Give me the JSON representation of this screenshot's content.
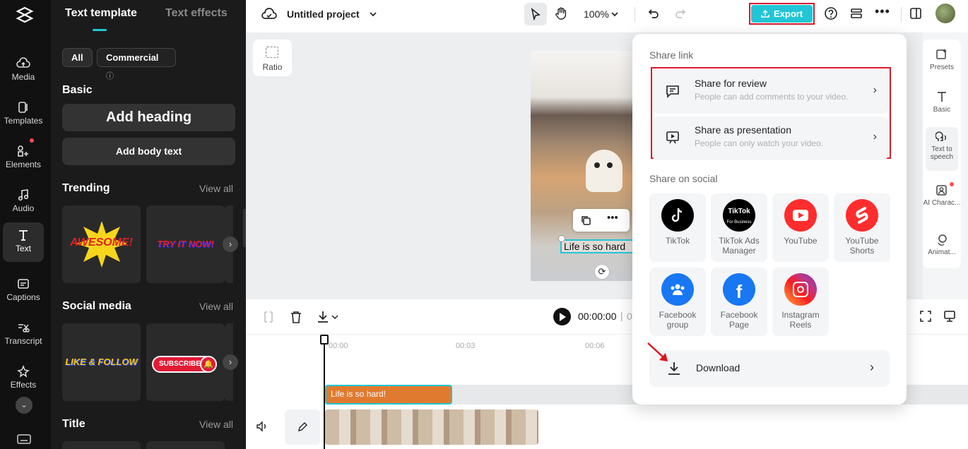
{
  "rail": {
    "items": [
      {
        "label": "Media"
      },
      {
        "label": "Templates"
      },
      {
        "label": "Elements"
      },
      {
        "label": "Audio"
      },
      {
        "label": "Text"
      },
      {
        "label": "Captions"
      },
      {
        "label": "Transcript"
      },
      {
        "label": "Effects"
      }
    ]
  },
  "panel": {
    "tabs": [
      "Text template",
      "Text effects"
    ],
    "filters": [
      "All",
      "Commercial"
    ],
    "basic": {
      "title": "Basic",
      "add_heading": "Add heading",
      "add_body": "Add body text"
    },
    "trending": {
      "title": "Trending",
      "view_all": "View all",
      "items": [
        "AWESOME!",
        "TRY IT NOW!"
      ]
    },
    "social": {
      "title": "Social media",
      "view_all": "View all",
      "items": [
        "LIKE & FOLLOW",
        "SUBSCRIBE"
      ]
    },
    "title_sec": {
      "title": "Title",
      "view_all": "View all"
    }
  },
  "topbar": {
    "project_name": "Untitled project",
    "zoom": "100%",
    "export_label": "Export"
  },
  "canvas": {
    "ratio_label": "Ratio",
    "caption_text": "Life is so hard"
  },
  "rightbar": {
    "items": [
      {
        "label": "Presets"
      },
      {
        "label": "Basic"
      },
      {
        "label": "Text to speech"
      },
      {
        "label": "AI Charac..."
      },
      {
        "label": "Animat..."
      }
    ]
  },
  "timeline": {
    "time": "00:00:00",
    "time_sep": "0",
    "ruler": [
      "00:00",
      "00:03",
      "00:06"
    ],
    "clip_text": "Life is so hard!"
  },
  "share": {
    "share_link_heading": "Share link",
    "review": {
      "title": "Share for review",
      "subtitle": "People can add comments to your video."
    },
    "presentation": {
      "title": "Share as presentation",
      "subtitle": "People can only watch your video."
    },
    "social_heading": "Share on social",
    "social": [
      {
        "label": "TikTok",
        "color": "#000000"
      },
      {
        "label": "TikTok Ads Manager",
        "color": "#000000"
      },
      {
        "label": "YouTube",
        "color": "#ff0000"
      },
      {
        "label": "YouTube Shorts",
        "color": "#ff2b2b"
      },
      {
        "label": "Facebook group",
        "color": "#1877f2"
      },
      {
        "label": "Facebook Page",
        "color": "#1877f2"
      },
      {
        "label": "Instagram Reels",
        "color": "#d62976"
      }
    ],
    "download_label": "Download"
  },
  "colors": {
    "accent": "#21c6d6",
    "highlight": "#d8192b",
    "clip": "#e07a2e"
  }
}
